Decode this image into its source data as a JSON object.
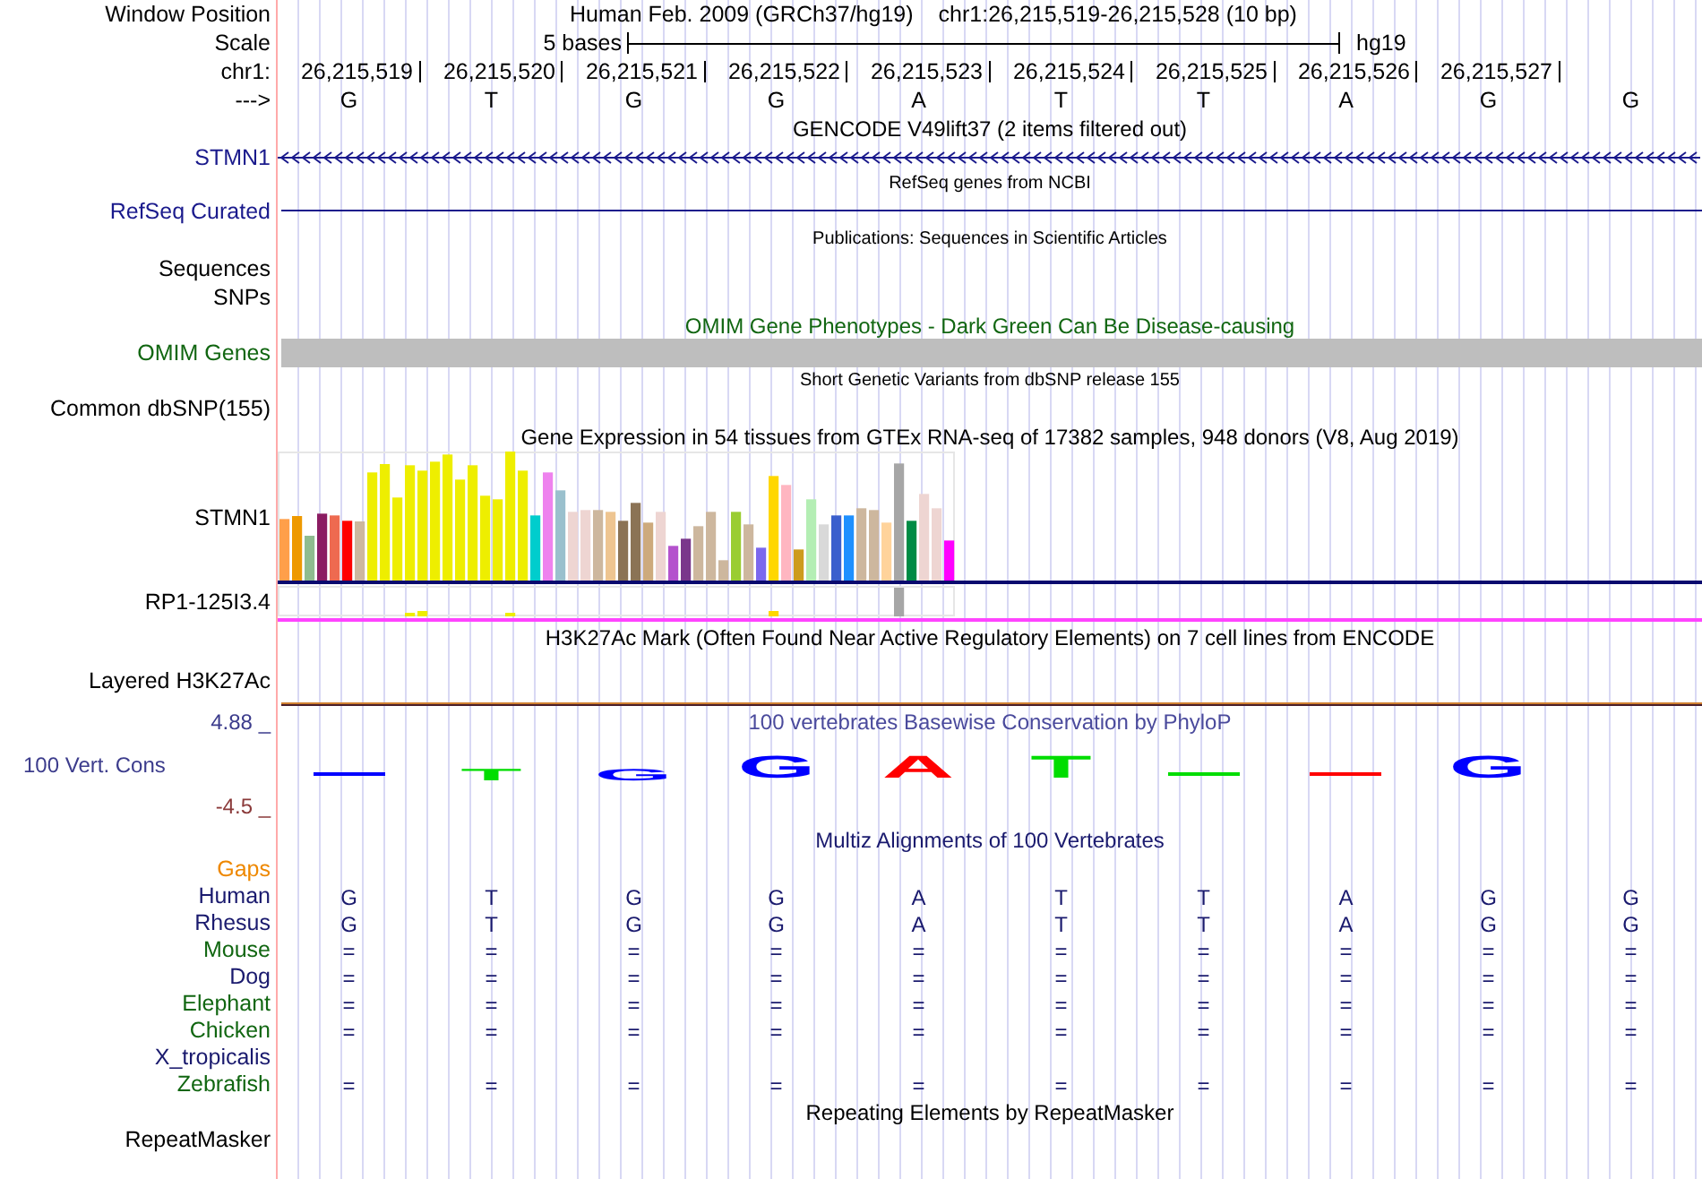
{
  "header": {
    "label": "Window Position",
    "assembly": "Human Feb. 2009 (GRCh37/hg19)",
    "position": "chr1:26,215,519-26,215,528 (10 bp)"
  },
  "scale": {
    "label": "Scale",
    "length": "5 bases",
    "assembly": "hg19"
  },
  "ruler": {
    "label": "chr1:",
    "positions": [
      "26,215,519",
      "26,215,520",
      "26,215,521",
      "26,215,522",
      "26,215,523",
      "26,215,524",
      "26,215,525",
      "26,215,526",
      "26,215,527"
    ]
  },
  "sequence": {
    "label": "--->",
    "bases": [
      "G",
      "T",
      "G",
      "G",
      "A",
      "T",
      "T",
      "A",
      "G",
      "G"
    ]
  },
  "tracks": [
    {
      "kind": "gene",
      "title": "GENCODE V49lift37 (2 items filtered out)",
      "labels": [
        "STMN1"
      ],
      "color": "#1a1a8c"
    },
    {
      "kind": "line",
      "title": "RefSeq genes from NCBI",
      "labels": [
        "RefSeq Curated"
      ],
      "color": "#1a1a8c"
    },
    {
      "kind": "blank_small",
      "title": "Publications: Sequences in Scientific Articles",
      "labels": [
        "Sequences",
        "SNPs"
      ],
      "color": "#000000"
    },
    {
      "kind": "bar",
      "title": "OMIM Gene Phenotypes - Dark Green Can Be Disease-causing",
      "labels": [
        "OMIM Genes"
      ],
      "color": "#116611"
    },
    {
      "kind": "blank_small",
      "title": "Short Genetic Variants from dbSNP release 155",
      "labels": [
        "Common dbSNP(155)"
      ],
      "color": "#000000"
    },
    {
      "kind": "expression",
      "title": "Gene Expression in 54 tissues from GTEx RNA-seq of 17382 samples, 948 donors (V8, Aug 2019)",
      "labels": [
        "STMN1",
        "RP1-125I3.4"
      ],
      "color": "#000000"
    },
    {
      "kind": "signal",
      "title": "H3K27Ac Mark (Often Found Near Active Regulatory Elements) on 7 cell lines from ENCODE",
      "labels": [
        "Layered H3K27Ac"
      ],
      "color": "#000000"
    },
    {
      "kind": "conservation",
      "title": "100 vertebrates Basewise Conservation by PhyloP",
      "labels": [
        "100 Vert. Cons"
      ],
      "color": "#3c3c8c",
      "max": "4.88 _",
      "min": "-4.5 _",
      "logo": [
        {
          "kind": "mark",
          "color": "#0000ff"
        },
        {
          "kind": "small",
          "base": "T",
          "color": "#00dd00"
        },
        {
          "kind": "small",
          "base": "G",
          "color": "#0000ff"
        },
        {
          "kind": "large",
          "base": "G",
          "color": "#0000ff"
        },
        {
          "kind": "large",
          "base": "A",
          "color": "#ff0000"
        },
        {
          "kind": "large",
          "base": "T",
          "color": "#00dd00"
        },
        {
          "kind": "mark",
          "color": "#00dd00"
        },
        {
          "kind": "mark",
          "color": "#ff0000"
        },
        {
          "kind": "large",
          "base": "G",
          "color": "#0000ff"
        }
      ]
    },
    {
      "kind": "alignment",
      "title": "Multiz Alignments of 100 Vertebrates",
      "gaps_label": "Gaps",
      "species": [
        {
          "name": "Human",
          "color": "#1a1a6e",
          "cells": [
            "G",
            "T",
            "G",
            "G",
            "A",
            "T",
            "T",
            "A",
            "G",
            "G"
          ]
        },
        {
          "name": "Rhesus",
          "color": "#1a1a6e",
          "cells": [
            "G",
            "T",
            "G",
            "G",
            "A",
            "T",
            "T",
            "A",
            "G",
            "G"
          ]
        },
        {
          "name": "Mouse",
          "color": "#116611",
          "cells": [
            "=",
            "=",
            "=",
            "=",
            "=",
            "=",
            "=",
            "=",
            "=",
            "="
          ]
        },
        {
          "name": "Dog",
          "color": "#1a1a6e",
          "cells": [
            "=",
            "=",
            "=",
            "=",
            "=",
            "=",
            "=",
            "=",
            "=",
            "="
          ]
        },
        {
          "name": "Elephant",
          "color": "#116611",
          "cells": [
            "=",
            "=",
            "=",
            "=",
            "=",
            "=",
            "=",
            "=",
            "=",
            "="
          ]
        },
        {
          "name": "Chicken",
          "color": "#116611",
          "cells": [
            "=",
            "=",
            "=",
            "=",
            "=",
            "=",
            "=",
            "=",
            "=",
            "="
          ]
        },
        {
          "name": "X_tropicalis",
          "color": "#1a1a6e"
        },
        {
          "name": "Zebrafish",
          "color": "#116611",
          "cells": [
            "=",
            "=",
            "=",
            "=",
            "=",
            "=",
            "=",
            "=",
            "=",
            "="
          ]
        }
      ]
    },
    {
      "kind": "blank",
      "title": "Repeating Elements by RepeatMasker",
      "labels": [
        "RepeatMasker"
      ],
      "color": "#000000"
    }
  ]
}
